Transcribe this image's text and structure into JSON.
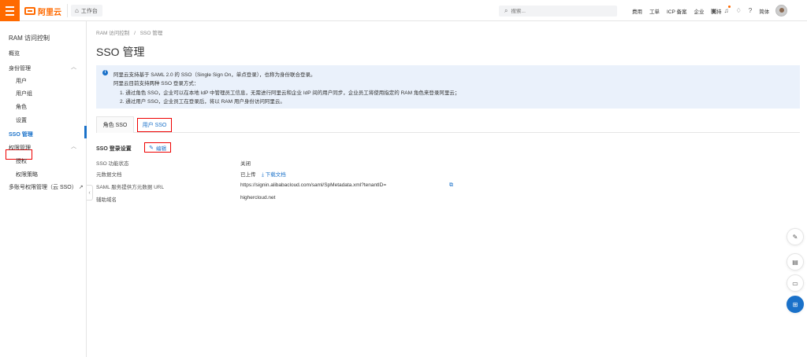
{
  "topbar": {
    "logo_text": "阿里云",
    "workbench_label": "工作台",
    "search_placeholder": "搜索...",
    "links": [
      "费用",
      "工单",
      "ICP 备案",
      "企业",
      "支持"
    ],
    "language": "简体"
  },
  "sidebar": {
    "title": "RAM 访问控制",
    "items": [
      {
        "label": "概览"
      },
      {
        "label": "身份管理",
        "expanded": true
      },
      {
        "label": "用户"
      },
      {
        "label": "用户组"
      },
      {
        "label": "角色"
      },
      {
        "label": "设置"
      },
      {
        "label": "SSO 管理",
        "active": true
      },
      {
        "label": "权限管理",
        "expanded": true
      },
      {
        "label": "授权"
      },
      {
        "label": "权限策略"
      },
      {
        "label": "多账号权限管理（云 SSO）"
      }
    ]
  },
  "breadcrumb": [
    "RAM 访问控制",
    "SSO 管理"
  ],
  "page_title": "SSO 管理",
  "info": {
    "lines": [
      "阿里云支持基于 SAML 2.0 的 SSO（Single Sign On，单点登录），也称为身份联合登录。",
      "阿里云目前支持两种 SSO 登录方式：",
      "1. 通过角色 SSO，企业可以在本地 IdP 中管理员工信息，无需进行阿里云和企业 IdP 间的用户同步，企业员工将使用指定的 RAM 角色来登录阿里云；",
      "2. 通过用户 SSO，企业员工在登录后，将以 RAM 用户身份访问阿里云。"
    ]
  },
  "tabs": [
    {
      "label": "角色 SSO",
      "active": false
    },
    {
      "label": "用户 SSO",
      "active": true
    }
  ],
  "section": {
    "title": "SSO 登录设置",
    "edit_label": "编辑"
  },
  "settings": [
    {
      "label": "SSO 功能状态",
      "value": "关闭"
    },
    {
      "label": "元数据文档",
      "value": "已上传",
      "action": "下载文档"
    },
    {
      "label": "SAML 服务提供方元数据 URL",
      "value": "https://signin.alibabacloud.com/saml/SpMetadata.xml?tenantID="
    },
    {
      "label": "辅助域名",
      "value": "highercloud.net"
    }
  ],
  "colors": {
    "brand": "#ff6a00",
    "accent": "#1a71c9",
    "highlight": "#e00000"
  }
}
